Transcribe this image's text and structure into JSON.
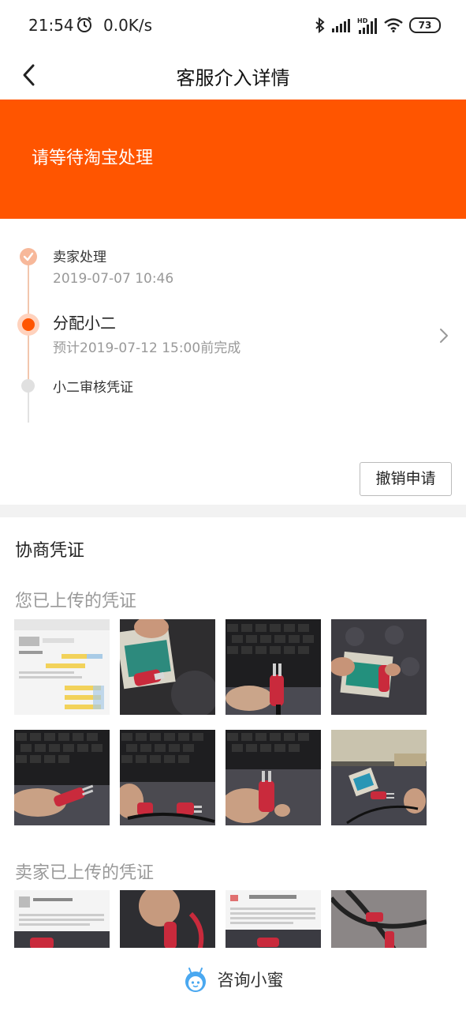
{
  "status_bar": {
    "time": "21:54",
    "net_speed": "0.0K/s",
    "battery": "73",
    "icons": [
      "alarm-icon",
      "bluetooth-icon",
      "signal-icon",
      "hd-signal-icon",
      "wifi-icon",
      "battery-icon"
    ]
  },
  "nav": {
    "back_icon": "back-arrow-icon",
    "title": "客服介入详情"
  },
  "banner": {
    "text": "请等待淘宝处理",
    "color": "#ff5500"
  },
  "timeline": {
    "steps": [
      {
        "title": "卖家处理",
        "subtitle": "2019-07-07 10:46",
        "state": "done"
      },
      {
        "title": "分配小二",
        "subtitle": "预计2019-07-12 15:00前完成",
        "state": "active"
      },
      {
        "title": "小二审核凭证",
        "subtitle": "",
        "state": "pending"
      }
    ],
    "revoke_label": "撤销申请"
  },
  "evidence": {
    "title": "协商凭证",
    "mine_label": "您已上传的凭证",
    "seller_label": "卖家已上传的凭证"
  },
  "bottom": {
    "label": "咨询小蜜",
    "icon": "xiaomi-assistant-icon"
  },
  "colors": {
    "accent": "#ff5500",
    "done_dot": "#f7b89a",
    "muted_text": "#999999"
  }
}
